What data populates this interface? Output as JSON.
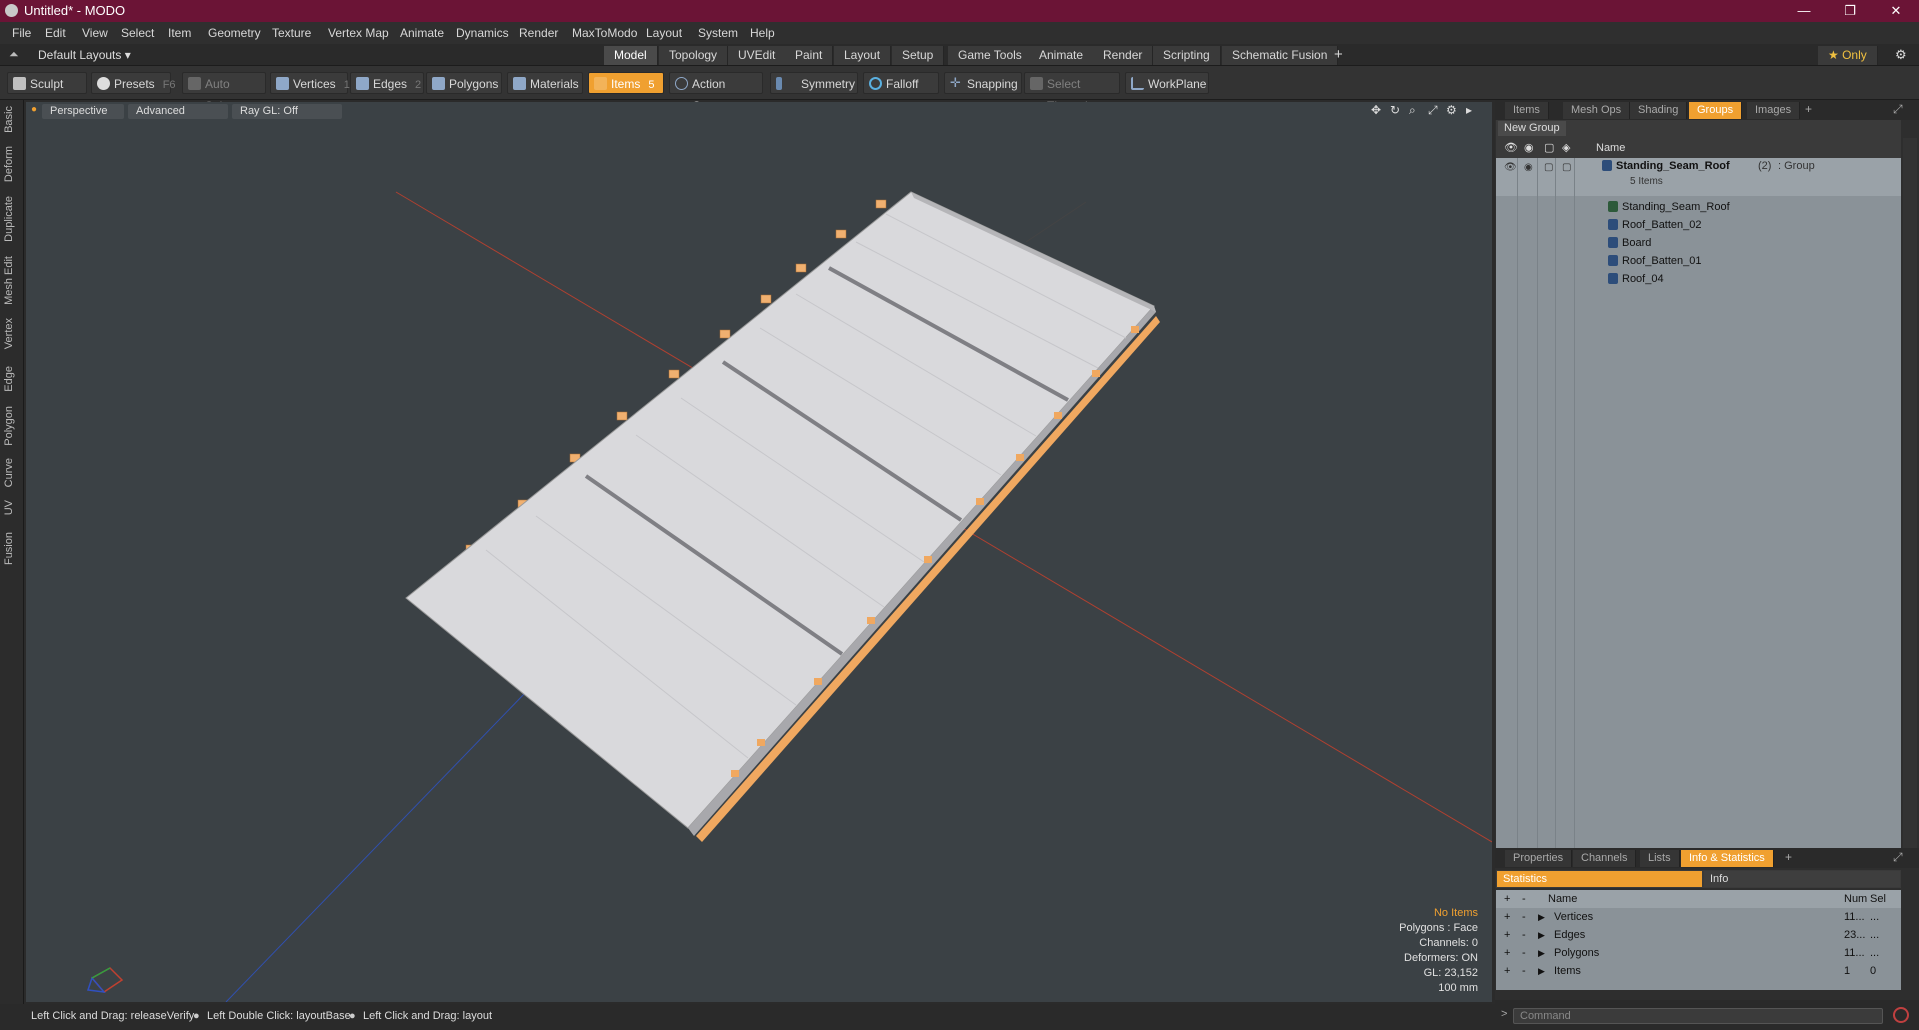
{
  "window": {
    "title": "Untitled* - MODO",
    "minimize": "—",
    "maximize": "❐",
    "close": "✕"
  },
  "menu": [
    "File",
    "Edit",
    "View",
    "Select",
    "Item",
    "Geometry",
    "Texture",
    "Vertex Map",
    "Animate",
    "Dynamics",
    "Render",
    "MaxToModo",
    "Layout",
    "System",
    "Help"
  ],
  "layout": {
    "selector": "Default Layouts ▾",
    "tabs": [
      "Model",
      "Topology",
      "UVEdit",
      "Paint",
      "Layout",
      "Setup",
      "Game Tools",
      "Animate",
      "Render",
      "Scripting",
      "Schematic Fusion"
    ],
    "active_tab": "Model",
    "add": "+",
    "only": "★ Only",
    "gear": "⚙"
  },
  "toolbar": {
    "sculpt": "Sculpt",
    "presets": "Presets",
    "presets_key": "F6",
    "auto_select": "Auto Select",
    "vertices": "Vertices",
    "vertices_num": "1",
    "edges": "Edges",
    "edges_num": "2",
    "polygons": "Polygons",
    "materials": "Materials",
    "items": "Items",
    "items_num": "5",
    "action_center": "Action Center",
    "symmetry": "Symmetry",
    "falloff": "Falloff",
    "snapping": "Snapping",
    "select_through": "Select Through",
    "workplane": "WorkPlane"
  },
  "left_tabs": [
    "Basic",
    "Deform",
    "Duplicate",
    "Mesh Edit",
    "Vertex",
    "Edge",
    "Polygon",
    "Curve",
    "UV",
    "Fusion"
  ],
  "viewport": {
    "view": "Perspective",
    "mode": "Advanced",
    "raygl": "Ray GL: Off",
    "info": {
      "items": "No Items",
      "polygons": "Polygons : Face",
      "channels": "Channels: 0",
      "deformers": "Deformers: ON",
      "gl": "GL: 23,152",
      "scale": "100 mm"
    },
    "colors": {
      "background": "#3b4145",
      "roof": "#d9d9dc",
      "seam": "#8a8a8e",
      "batten": "#f0b070",
      "x_axis": "#c04030",
      "z_axis": "#3050c0"
    }
  },
  "status": {
    "hint1": "Left Click and Drag: releaseVerify",
    "hint2": "Left Double Click: layoutBase",
    "hint3": "Left Click and Drag: layout"
  },
  "groups_panel": {
    "tabs": [
      "Items",
      "Mesh Ops",
      "Shading",
      "Groups",
      "Images"
    ],
    "active_tab": "Groups",
    "new_group": "New Group",
    "col_name": "Name",
    "group": {
      "name": "Standing_Seam_Roof",
      "count": "(2)",
      "kind": ": Group",
      "sub": "5 Items"
    },
    "children": [
      "Standing_Seam_Roof",
      "Roof_Batten_02",
      "Board",
      "Roof_Batten_01",
      "Roof_04"
    ]
  },
  "stats_panel": {
    "tabs": [
      "Properties",
      "Channels",
      "Lists",
      "Info & Statistics"
    ],
    "active_tab": "Info & Statistics",
    "sub_tabs": [
      "Statistics",
      "Info"
    ],
    "cols": [
      "Name",
      "Num",
      "Sel"
    ],
    "rows": [
      {
        "name": "Vertices",
        "num": "11...",
        "sel": "..."
      },
      {
        "name": "Edges",
        "num": "23...",
        "sel": "..."
      },
      {
        "name": "Polygons",
        "num": "11...",
        "sel": "..."
      },
      {
        "name": "Items",
        "num": "1",
        "sel": "0"
      }
    ]
  },
  "command": {
    "placeholder": "Command"
  }
}
